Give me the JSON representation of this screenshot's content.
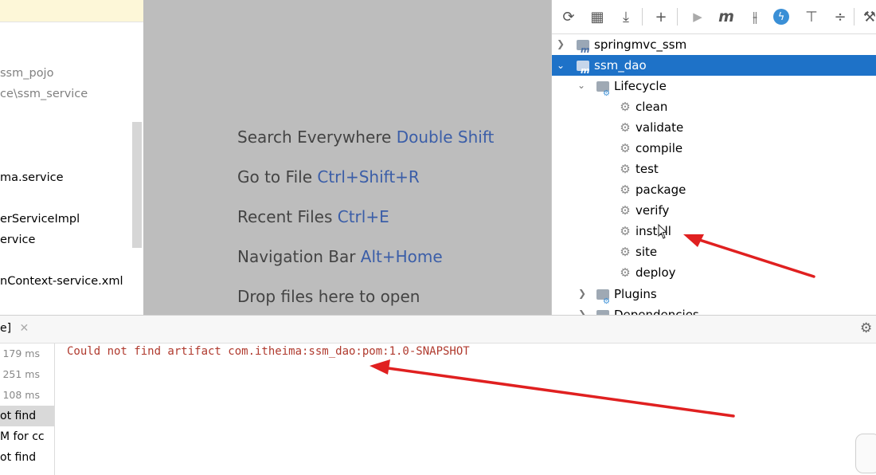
{
  "project_tree": {
    "rows": [
      {
        "text": "ssm_pojo",
        "color": "#808080"
      },
      {
        "text": "ce\\ssm_service",
        "color": "#808080"
      },
      {
        "text": "ma.service",
        "color": "#000000"
      },
      {
        "text": "erServiceImpl",
        "color": "#000000"
      },
      {
        "text": "ervice",
        "color": "#000000"
      },
      {
        "text": "nContext-service.xml",
        "color": "#000000"
      }
    ]
  },
  "editor_hints": [
    {
      "label": "Search Everywhere",
      "key": "Double Shift"
    },
    {
      "label": "Go to File",
      "key": "Ctrl+Shift+R"
    },
    {
      "label": "Recent Files",
      "key": "Ctrl+E"
    },
    {
      "label": "Navigation Bar",
      "key": "Alt+Home"
    },
    {
      "label": "Drop files here to open",
      "key": ""
    }
  ],
  "maven": {
    "toolbar": [
      {
        "icon": "reload-icon",
        "glyph": "⟳"
      },
      {
        "icon": "generate-sources-icon",
        "glyph": "▦"
      },
      {
        "icon": "download-icon",
        "glyph": "⤓"
      },
      {
        "icon": "add-icon",
        "glyph": "+"
      },
      {
        "icon": "run-icon",
        "glyph": "▶"
      },
      {
        "icon": "execute-goal-icon",
        "glyph": "m"
      },
      {
        "icon": "toggle-offline-icon",
        "glyph": "⫲"
      },
      {
        "icon": "skip-tests-icon",
        "glyph": "ϟ"
      },
      {
        "icon": "show-dependencies-icon",
        "glyph": "⊤"
      },
      {
        "icon": "collapse-all-icon",
        "glyph": "÷"
      },
      {
        "icon": "settings-wrench-icon",
        "glyph": "⚒"
      }
    ],
    "projects": [
      {
        "name": "springmvc_ssm"
      },
      {
        "name": "ssm_dao"
      }
    ],
    "lifecycle_label": "Lifecycle",
    "lifecycle_goals": [
      "clean",
      "validate",
      "compile",
      "test",
      "package",
      "verify",
      "install",
      "site",
      "deploy"
    ],
    "plugins_label": "Plugins",
    "dependencies_label": "Dependencies"
  },
  "run_panel": {
    "tab_label": "e]",
    "history": [
      {
        "text": "179 ms",
        "kind": "ms"
      },
      {
        "text": "251 ms",
        "kind": "ms"
      },
      {
        "text": "108 ms",
        "kind": "ms"
      },
      {
        "text": "ot find",
        "kind": "text",
        "selected": true
      },
      {
        "text": "M for cc",
        "kind": "text"
      },
      {
        "text": "ot find",
        "kind": "text"
      }
    ],
    "console_line": "Could not find artifact com.itheima:ssm_dao:pom:1.0-SNAPSHOT"
  },
  "colors": {
    "selection": "#1e72c8",
    "hint_key": "#3b5ea8",
    "console_error": "#b03a2e",
    "annotation": "#e02020"
  }
}
